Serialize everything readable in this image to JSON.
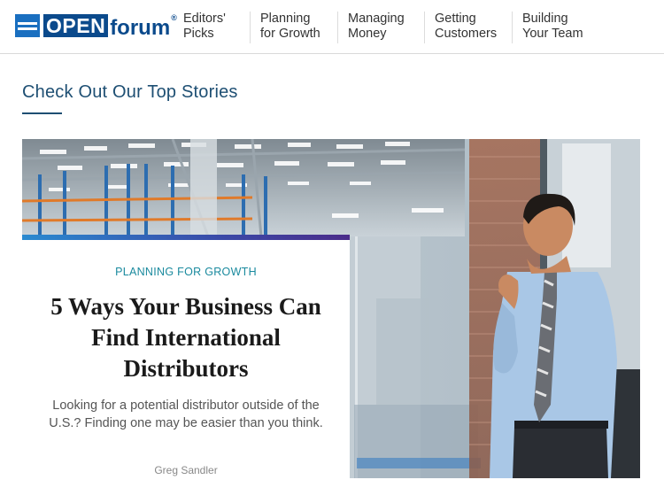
{
  "brand": {
    "open": "OPEN",
    "forum": "forum",
    "registered": "®",
    "colors": {
      "primary": "#0b4a8c",
      "amex_blue": "#1a6fc0"
    },
    "icon": "amex-logo-icon"
  },
  "nav": {
    "items": [
      {
        "label": "Editors'\nPicks"
      },
      {
        "label": "Planning\nfor Growth"
      },
      {
        "label": "Managing\nMoney"
      },
      {
        "label": "Getting\nCustomers"
      },
      {
        "label": "Building\nYour Team"
      }
    ]
  },
  "section": {
    "title": "Check Out Our Top Stories",
    "accent": "#1e4f73"
  },
  "feature": {
    "category": "PLANNING FOR GROWTH",
    "title": "5 Ways Your Business Can Find International Distributors",
    "description": "Looking for a potential distributor outside of the U.S.? Finding one may be easier than you think.",
    "author": "Greg Sandler",
    "category_color": "#1a8a9e"
  }
}
